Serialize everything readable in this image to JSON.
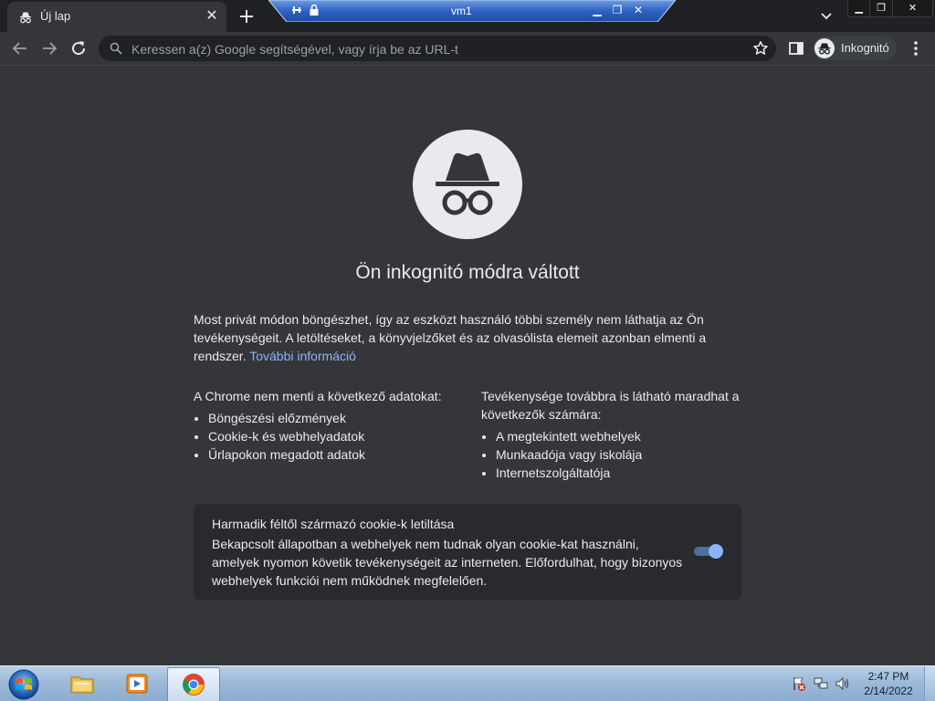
{
  "browser": {
    "tab": {
      "title": "Új lap",
      "icon": "incognito-icon",
      "close_icon": "close-icon"
    },
    "new_tab_icon": "plus-icon",
    "tab_search_icon": "chevron-down-icon"
  },
  "vm_bar": {
    "title": "vm1",
    "pin_icon": "pin-icon",
    "lock_icon": "lock-icon",
    "minimize_icon": "minimize-icon",
    "restore_icon": "restore-icon",
    "close_icon": "close-icon"
  },
  "window_controls": {
    "minimize": "minimize-icon",
    "maximize": "restore-icon",
    "close": "close-icon"
  },
  "toolbar": {
    "back_icon": "arrow-left-icon",
    "forward_icon": "arrow-right-icon",
    "reload_icon": "reload-icon",
    "omnibox_placeholder": "Keressen a(z) Google segítségével, vagy írja be az URL-t",
    "omnibox_value": "",
    "bookmark_icon": "star-icon",
    "side_panel_icon": "side-panel-icon",
    "profile_label": "Inkognitó",
    "menu_icon": "kebab-menu-icon"
  },
  "page": {
    "title": "Ön inkognitó módra váltott",
    "intro": "Most privát módon böngészhet, így az eszközt használó többi személy nem láthatja az Ön tevékenységeit. A letöltéseket, a könyvjelzőket és az olvasólista elemeit azonban elmenti a rendszer.",
    "learn_more": "További információ",
    "not_saved": {
      "heading": "A Chrome nem menti a következő adatokat:",
      "items": [
        "Böngészési előzmények",
        "Cookie-k és webhelyadatok",
        "Űrlapokon megadott adatok"
      ]
    },
    "visible_to": {
      "heading": "Tevékenysége továbbra is látható maradhat a következők számára:",
      "items": [
        "A megtekintett webhelyek",
        "Munkaadója vagy iskolája",
        "Internetszolgáltatója"
      ]
    },
    "cookie_card": {
      "title": "Harmadik féltől származó cookie-k letiltása",
      "description": "Bekapcsolt állapotban a webhelyek nem tudnak olyan cookie-kat használni, amelyek nyomon követik tevékenységeit az interneten. Előfordulhat, hogy bizonyos webhelyek funkciói nem működnek megfelelően.",
      "toggle_on": true
    }
  },
  "taskbar": {
    "start_icon": "windows-start-icon",
    "apps": [
      {
        "name": "explorer",
        "icon": "folder-icon",
        "active": false
      },
      {
        "name": "media-player",
        "icon": "media-player-icon",
        "active": false
      },
      {
        "name": "chrome",
        "icon": "chrome-icon",
        "active": true
      }
    ],
    "tray_icons": [
      "action-center-icon",
      "network-icon",
      "volume-icon"
    ],
    "clock": {
      "time": "2:47 PM",
      "date": "2/14/2022"
    }
  },
  "colors": {
    "accent": "#8ab4f8",
    "page_bg": "#35363a",
    "tabstrip_bg": "#202124",
    "card_bg": "#292a2d"
  }
}
